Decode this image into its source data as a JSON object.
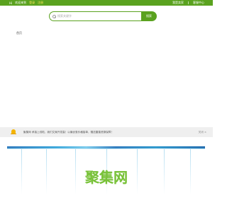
{
  "topbar": {
    "items": [
      "Hi",
      "欢迎来到",
      "登录",
      "注册"
    ],
    "right_items": [
      "我是卖家",
      "|",
      "客服中心"
    ]
  },
  "search": {
    "placeholder": "搜索关键字",
    "button_label": "搜索"
  },
  "breadcrumb": "首页",
  "notice": {
    "text": "聚集网 承接上线啦，我们文案开发高！以最优惠价格接单，赠送雷霆资源保障！",
    "close_label": "关闭 ×"
  },
  "logo_text": "聚集网",
  "colors": {
    "brand_green": "#5aa21f",
    "logo_green": "#79c23a",
    "notice_bg": "#efefef",
    "highlight": "#ffe65a"
  },
  "icons": [
    "search-icon",
    "bell-icon",
    "close-icon"
  ]
}
